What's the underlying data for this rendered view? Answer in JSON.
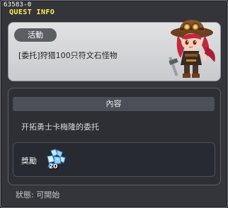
{
  "window": {
    "id_label": "63583-0",
    "title": "QUEST INFO"
  },
  "summary": {
    "category_badge": "活動",
    "quest_title": "[委托]狩猎100只符文石怪物"
  },
  "details": {
    "section_header": "內容",
    "description": "开拓勇士卡梅隆的委托"
  },
  "reward": {
    "label": "獎勵",
    "item_icon": "blue-crystal-icon",
    "quantity": "20"
  },
  "status": {
    "text": "狀態: 可開始"
  },
  "colors": {
    "title_accent": "#ffee55",
    "window_bg": "#33353a",
    "top_card_bg": "#d6d7d9",
    "badge_bg": "#5b5e63"
  }
}
